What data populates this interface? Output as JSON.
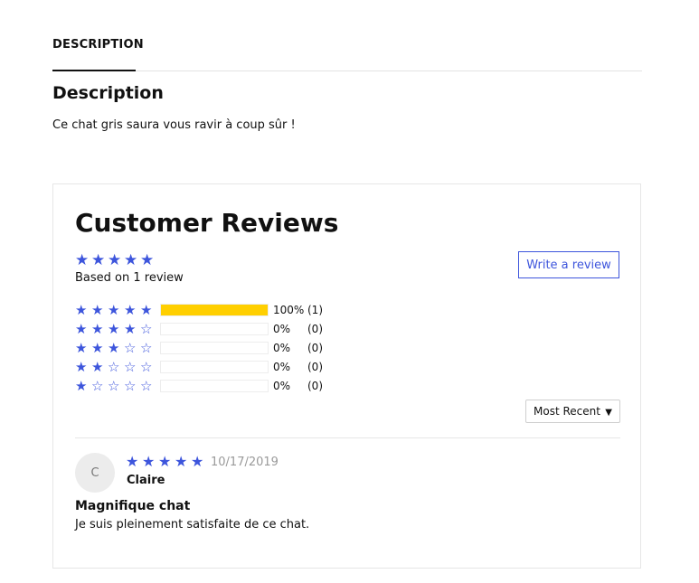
{
  "tabs": [
    {
      "label": "DESCRIPTION"
    }
  ],
  "description": {
    "heading": "Description",
    "text": "Ce chat gris saura vous ravir à coup sûr !"
  },
  "reviews": {
    "title": "Customer Reviews",
    "summary_rating": 5,
    "based_on": "Based on 1 review",
    "write_label": "Write a review",
    "histogram": [
      {
        "stars": 5,
        "percent_label": "100%",
        "count_label": "(1)",
        "fraction": 1.0
      },
      {
        "stars": 4,
        "percent_label": "0%",
        "count_label": "(0)",
        "fraction": 0.0
      },
      {
        "stars": 3,
        "percent_label": "0%",
        "count_label": "(0)",
        "fraction": 0.0
      },
      {
        "stars": 2,
        "percent_label": "0%",
        "count_label": "(0)",
        "fraction": 0.0
      },
      {
        "stars": 1,
        "percent_label": "0%",
        "count_label": "(0)",
        "fraction": 0.0
      }
    ],
    "sort_label": "Most Recent",
    "items": [
      {
        "avatar_initial": "C",
        "rating": 5,
        "date": "10/17/2019",
        "author": "Claire",
        "title": "Magnifique chat",
        "body": "Je suis pleinement satisfaite de ce chat."
      }
    ]
  },
  "colors": {
    "star": "#3d55dc",
    "bar_fill": "#ffcf00",
    "accent": "#3d55dc"
  },
  "icons": {
    "star_filled": "star-filled-icon",
    "star_empty": "star-empty-icon",
    "dropdown": "caret-down-icon"
  }
}
